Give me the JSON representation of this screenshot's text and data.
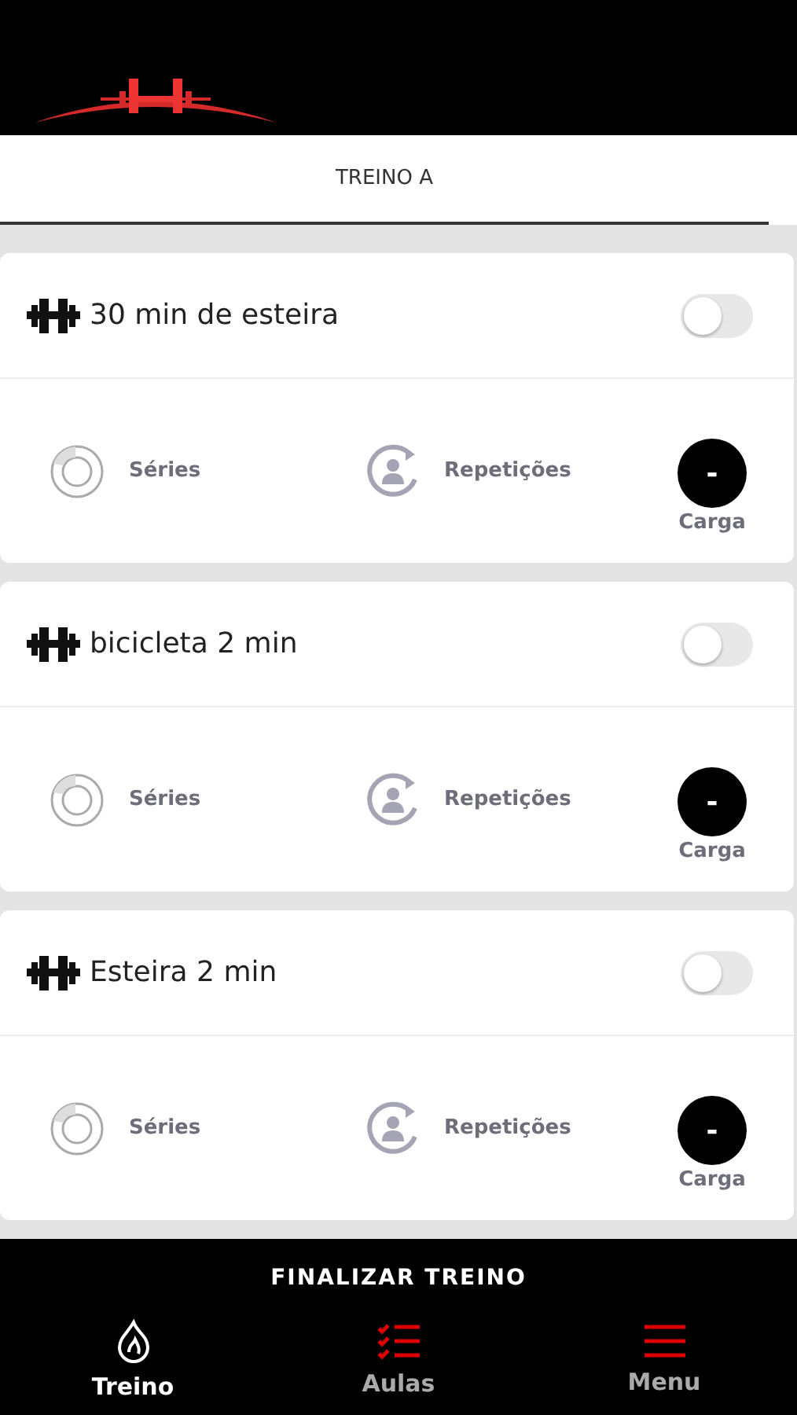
{
  "tabs": [
    {
      "label": "TREINO A",
      "selected": true
    }
  ],
  "exercises": [
    {
      "name": "30 min de esteira",
      "on": false,
      "series_label": "Séries",
      "reps_label": "Repetições",
      "load_value": "-",
      "load_label": "Carga"
    },
    {
      "name": "bicicleta 2 min",
      "on": false,
      "series_label": "Séries",
      "reps_label": "Repetições",
      "load_value": "-",
      "load_label": "Carga"
    },
    {
      "name": "Esteira 2 min",
      "on": false,
      "series_label": "Séries",
      "reps_label": "Repetições",
      "load_value": "-",
      "load_label": "Carga"
    }
  ],
  "finish_button": "FINALIZAR TREINO",
  "nav": [
    {
      "label": "Treino",
      "kind": "flame",
      "selected": true
    },
    {
      "label": "Aulas",
      "kind": "checklist",
      "selected": false
    },
    {
      "label": "Menu",
      "kind": "menu",
      "selected": false
    }
  ]
}
